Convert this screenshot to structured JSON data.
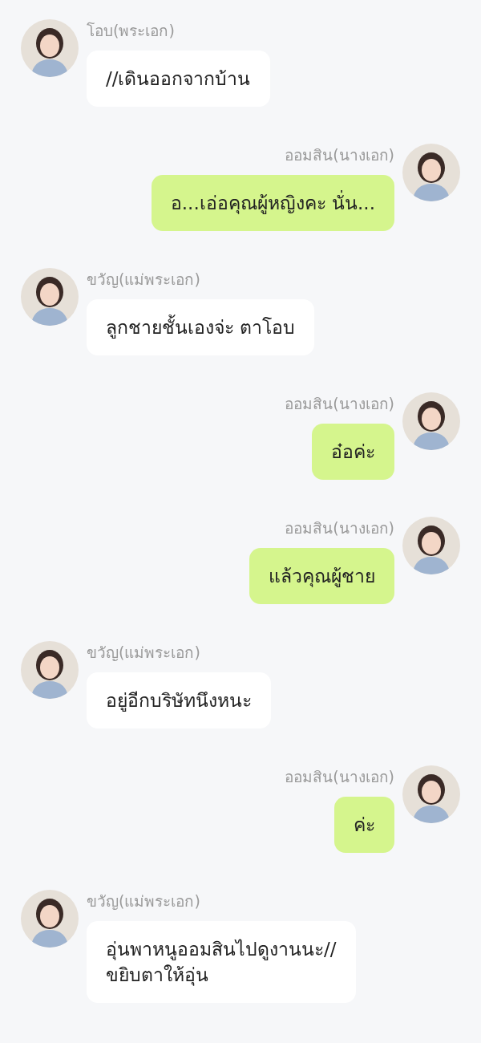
{
  "messages": [
    {
      "outgoing": false,
      "sender": "โอบ(พระเอก)",
      "text": "//เดินออกจากบ้าน"
    },
    {
      "outgoing": true,
      "sender": "ออมสิน(นางเอก)",
      "text": "อ...เอ่อคุณผู้หญิงคะ นั่น..."
    },
    {
      "outgoing": false,
      "sender": "ขวัญ(แม่พระเอก)",
      "text": "ลูกชายชั้นเองจ่ะ ตาโอบ"
    },
    {
      "outgoing": true,
      "sender": "ออมสิน(นางเอก)",
      "text": "อ๋อค่ะ"
    },
    {
      "outgoing": true,
      "sender": "ออมสิน(นางเอก)",
      "text": "แล้วคุณผู้ชาย"
    },
    {
      "outgoing": false,
      "sender": "ขวัญ(แม่พระเอก)",
      "text": "อยู่อีกบริษัทนึงหนะ"
    },
    {
      "outgoing": true,
      "sender": "ออมสิน(นางเอก)",
      "text": "ค่ะ"
    },
    {
      "outgoing": false,
      "sender": "ขวัญ(แม่พระเอก)",
      "text": "อุ่นพาหนูออมสินไปดูงานนะ//\nขยิบตาให้อุ่น"
    }
  ]
}
